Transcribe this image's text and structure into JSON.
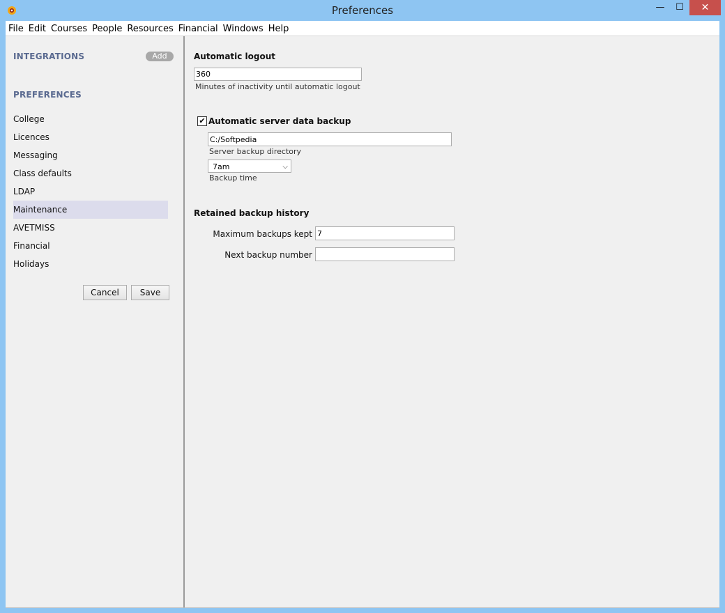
{
  "window": {
    "title": "Preferences",
    "icons": {
      "app": "app-logo-icon",
      "minimize": "minimize-icon",
      "maximize": "maximize-icon",
      "close": "close-icon"
    },
    "minimize_glyph": "—",
    "maximize_glyph": "☐",
    "close_glyph": "✕"
  },
  "menu": [
    "File",
    "Edit",
    "Courses",
    "People",
    "Resources",
    "Financial",
    "Windows",
    "Help"
  ],
  "sidebar": {
    "integrations_heading": "INTEGRATIONS",
    "add_label": "Add",
    "preferences_heading": "PREFERENCES",
    "items": [
      {
        "label": "College"
      },
      {
        "label": "Licences"
      },
      {
        "label": "Messaging"
      },
      {
        "label": "Class defaults"
      },
      {
        "label": "LDAP"
      },
      {
        "label": "Maintenance",
        "selected": true
      },
      {
        "label": "AVETMISS"
      },
      {
        "label": "Financial"
      },
      {
        "label": "Holidays"
      }
    ],
    "cancel_label": "Cancel",
    "save_label": "Save"
  },
  "main": {
    "logout": {
      "heading": "Automatic logout",
      "value": "360",
      "hint": "Minutes of inactivity until automatic logout"
    },
    "backup": {
      "checkbox_label": "Automatic server data backup",
      "checked": true,
      "check_glyph": "✔",
      "directory_value": "C:/Softpedia",
      "directory_hint": "Server backup directory",
      "time_value": "7am",
      "time_hint": "Backup time",
      "dropdown_glyph": "⌵"
    },
    "retained": {
      "heading": "Retained backup history",
      "max_label": "Maximum backups kept",
      "max_value": "7",
      "next_label": "Next backup number",
      "next_value": ""
    }
  },
  "colors": {
    "window_frame": "#8ec5f2",
    "sidebar_heading": "#5a6a90",
    "selected_nav": "#dcdcec",
    "close_button": "#c7504c"
  }
}
